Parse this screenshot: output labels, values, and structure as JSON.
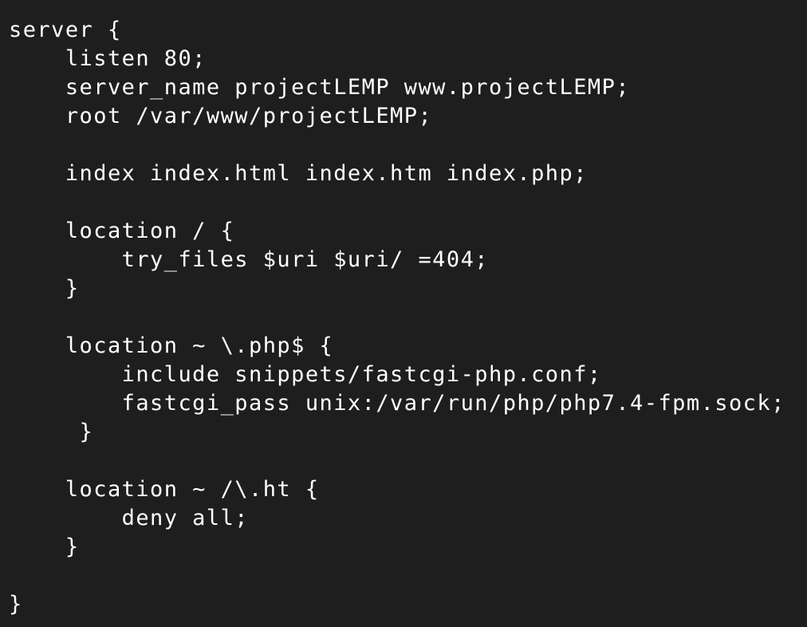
{
  "terminal": {
    "background": "#1e1e1e",
    "text_color": "#ffffff",
    "lines": [
      "server {",
      "    listen 80;",
      "    server_name projectLEMP www.projectLEMP;",
      "    root /var/www/projectLEMP;",
      "",
      "    index index.html index.htm index.php;",
      "",
      "    location / {",
      "        try_files $uri $uri/ =404;",
      "    }",
      "",
      "    location ~ \\.php$ {",
      "        include snippets/fastcgi-php.conf;",
      "        fastcgi_pass unix:/var/run/php/php7.4-fpm.sock;",
      "     }",
      "",
      "    location ~ /\\.ht {",
      "        deny all;",
      "    }",
      "",
      "}"
    ]
  }
}
